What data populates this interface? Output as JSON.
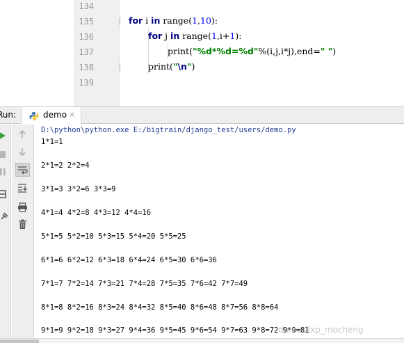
{
  "editor": {
    "line_numbers": [
      "134",
      "135",
      "136",
      "137",
      "138",
      "139"
    ],
    "line135": {
      "kw_for": "for",
      "var": " i ",
      "kw_in": "in",
      "call": " range(",
      "n1": "1",
      "comma": ",",
      "n2": "10",
      "end": "):"
    },
    "line136": {
      "kw_for": "for",
      "var": " j ",
      "kw_in": "in",
      "call": " range(",
      "n1": "1",
      "mid": ",i+",
      "n2": "1",
      "end": "):"
    },
    "line137": {
      "call": "print(",
      "str": "\"%d*%d=%d\"",
      "args": "%(i,j,i*j),end=",
      "str2": "\" \"",
      "end": ")"
    },
    "line138": {
      "call": "print(",
      "q1": "\"",
      "esc": "\\n",
      "q2": "\"",
      "end": ")"
    }
  },
  "run_panel": {
    "label": "Run:",
    "tab_label": "demo",
    "tab_close": "×",
    "command": "D:\\python\\python.exe E:/bigtrain/django_test/users/demo.py",
    "output_lines": [
      "1*1=1",
      "2*1=2 2*2=4",
      "3*1=3 3*2=6 3*3=9",
      "4*1=4 4*2=8 4*3=12 4*4=16",
      "5*1=5 5*2=10 5*3=15 5*4=20 5*5=25",
      "6*1=6 6*2=12 6*3=18 6*4=24 6*5=30 6*6=36",
      "7*1=7 7*2=14 7*3=21 7*4=28 7*5=35 7*6=42 7*7=49",
      "8*1=8 8*2=16 8*3=24 8*4=32 8*5=40 8*6=48 8*7=56 8*8=64",
      "9*1=9 9*2=18 9*3=27 9*4=36 9*5=45 9*6=54 9*7=63 9*8=72 9*9=81"
    ],
    "toolbar_icons": [
      "run-icon",
      "stop-icon",
      "pause-icon",
      "layout-icon",
      "pin-icon",
      "up-arrow-icon",
      "down-arrow-icon",
      "soft-wrap-icon",
      "scroll-to-end-icon",
      "print-icon",
      "trash-icon"
    ]
  },
  "watermark": "dn.net/lxp_mocheng",
  "colors": {
    "keyword": "#000080",
    "number": "#0000ff",
    "string": "#008000",
    "run_green": "#3a9e3a",
    "accent_blue": "#4a7ec2"
  }
}
